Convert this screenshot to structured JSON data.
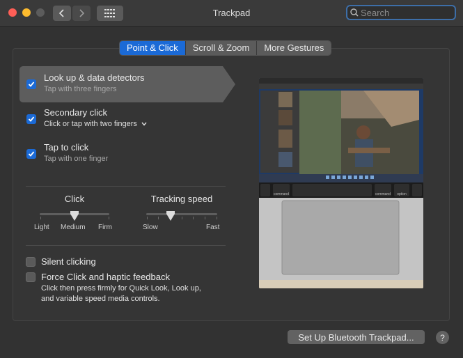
{
  "window": {
    "title": "Trackpad"
  },
  "search": {
    "placeholder": "Search"
  },
  "tabs": [
    {
      "label": "Point & Click",
      "active": true
    },
    {
      "label": "Scroll & Zoom",
      "active": false
    },
    {
      "label": "More Gestures",
      "active": false
    }
  ],
  "options": [
    {
      "title": "Look up & data detectors",
      "subtitle": "Tap with three fingers",
      "checked": true,
      "selected": true
    },
    {
      "title": "Secondary click",
      "subtitle": "Click or tap with two fingers",
      "checked": true,
      "has_dropdown": true
    },
    {
      "title": "Tap to click",
      "subtitle": "Tap with one finger",
      "checked": true
    }
  ],
  "sliders": {
    "click": {
      "label": "Click",
      "marks": [
        "Light",
        "Medium",
        "Firm"
      ],
      "value": "Medium",
      "position": 0.5
    },
    "tracking": {
      "label": "Tracking speed",
      "marks": [
        "Slow",
        "Fast"
      ],
      "position": 0.35
    }
  },
  "bottom_options": [
    {
      "title": "Silent clicking",
      "checked": false
    },
    {
      "title": "Force Click and haptic feedback",
      "checked": false,
      "description_line1": "Click then press firmly for Quick Look, Look up,",
      "description_line2": "and variable speed media controls."
    }
  ],
  "preview": {
    "keys": [
      "option",
      "command",
      "command",
      "option"
    ]
  },
  "buttons": {
    "bluetooth": "Set Up Bluetooth Trackpad...",
    "help": "?"
  },
  "colors": {
    "accent": "#1b6ad6",
    "background": "#323232"
  }
}
